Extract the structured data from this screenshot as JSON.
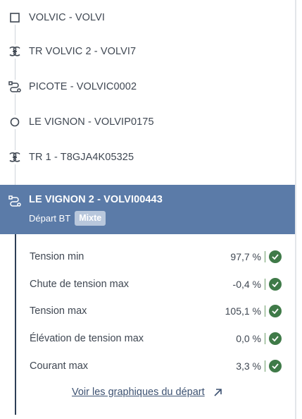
{
  "tree": {
    "items": [
      {
        "label": "VOLVIC - VOLVI",
        "icon": "square-icon"
      },
      {
        "label": "TR VOLVIC 2 - VOLVI7",
        "icon": "transformer-icon"
      },
      {
        "label": "PICOTE - VOLVIC0002",
        "icon": "route-icon"
      },
      {
        "label": "LE VIGNON - VOLVIP0175",
        "icon": "circle-icon"
      },
      {
        "label": "TR 1 - T8GJA4K05325",
        "icon": "transformer-icon"
      }
    ],
    "selected": {
      "title": "LE VIGNON 2 - VOLVI00443",
      "subtitle": "Départ BT",
      "badge": "Mixte",
      "icon": "route-icon"
    }
  },
  "details": {
    "metrics": [
      {
        "name": "Tension min",
        "value": "97,7 %",
        "status": "ok"
      },
      {
        "name": "Chute de tension max",
        "value": "-0,4 %",
        "status": "ok"
      },
      {
        "name": "Tension max",
        "value": "105,1 %",
        "status": "ok"
      },
      {
        "name": "Élévation de tension max",
        "value": "0,0 %",
        "status": "ok"
      },
      {
        "name": "Courant max",
        "value": "3,3 %",
        "status": "ok"
      }
    ],
    "link_label": "Voir les graphiques du départ"
  },
  "colors": {
    "selected_bg": "#5b7ba8",
    "badge_bg": "#b8c7dc",
    "ok_green": "#3f7a48",
    "link": "#3d5272"
  }
}
